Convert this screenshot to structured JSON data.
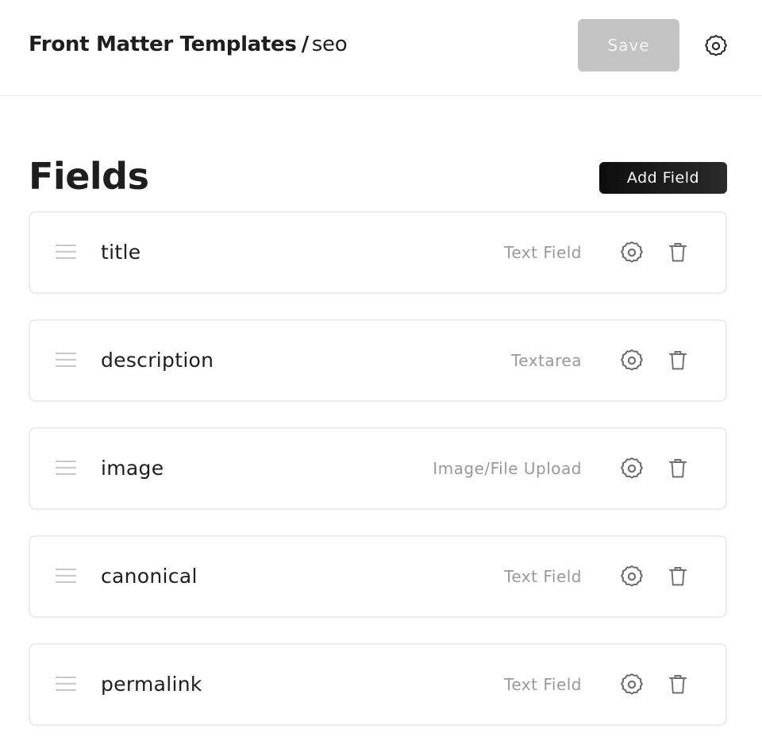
{
  "header": {
    "breadcrumb_root": "Front Matter Templates",
    "breadcrumb_separator": "/",
    "breadcrumb_current": "seo",
    "save_label": "Save",
    "settings_icon": "gear-icon"
  },
  "main": {
    "title": "Fields",
    "add_field_label": "Add Field"
  },
  "fields": [
    {
      "name": "title",
      "type": "Text Field"
    },
    {
      "name": "description",
      "type": "Textarea"
    },
    {
      "name": "image",
      "type": "Image/File Upload"
    },
    {
      "name": "canonical",
      "type": "Text Field"
    },
    {
      "name": "permalink",
      "type": "Text Field"
    }
  ],
  "colors": {
    "save_disabled_bg": "#c3c3c3",
    "primary_button_bg": "#111111",
    "muted_text": "#999999",
    "border": "#ececec"
  }
}
